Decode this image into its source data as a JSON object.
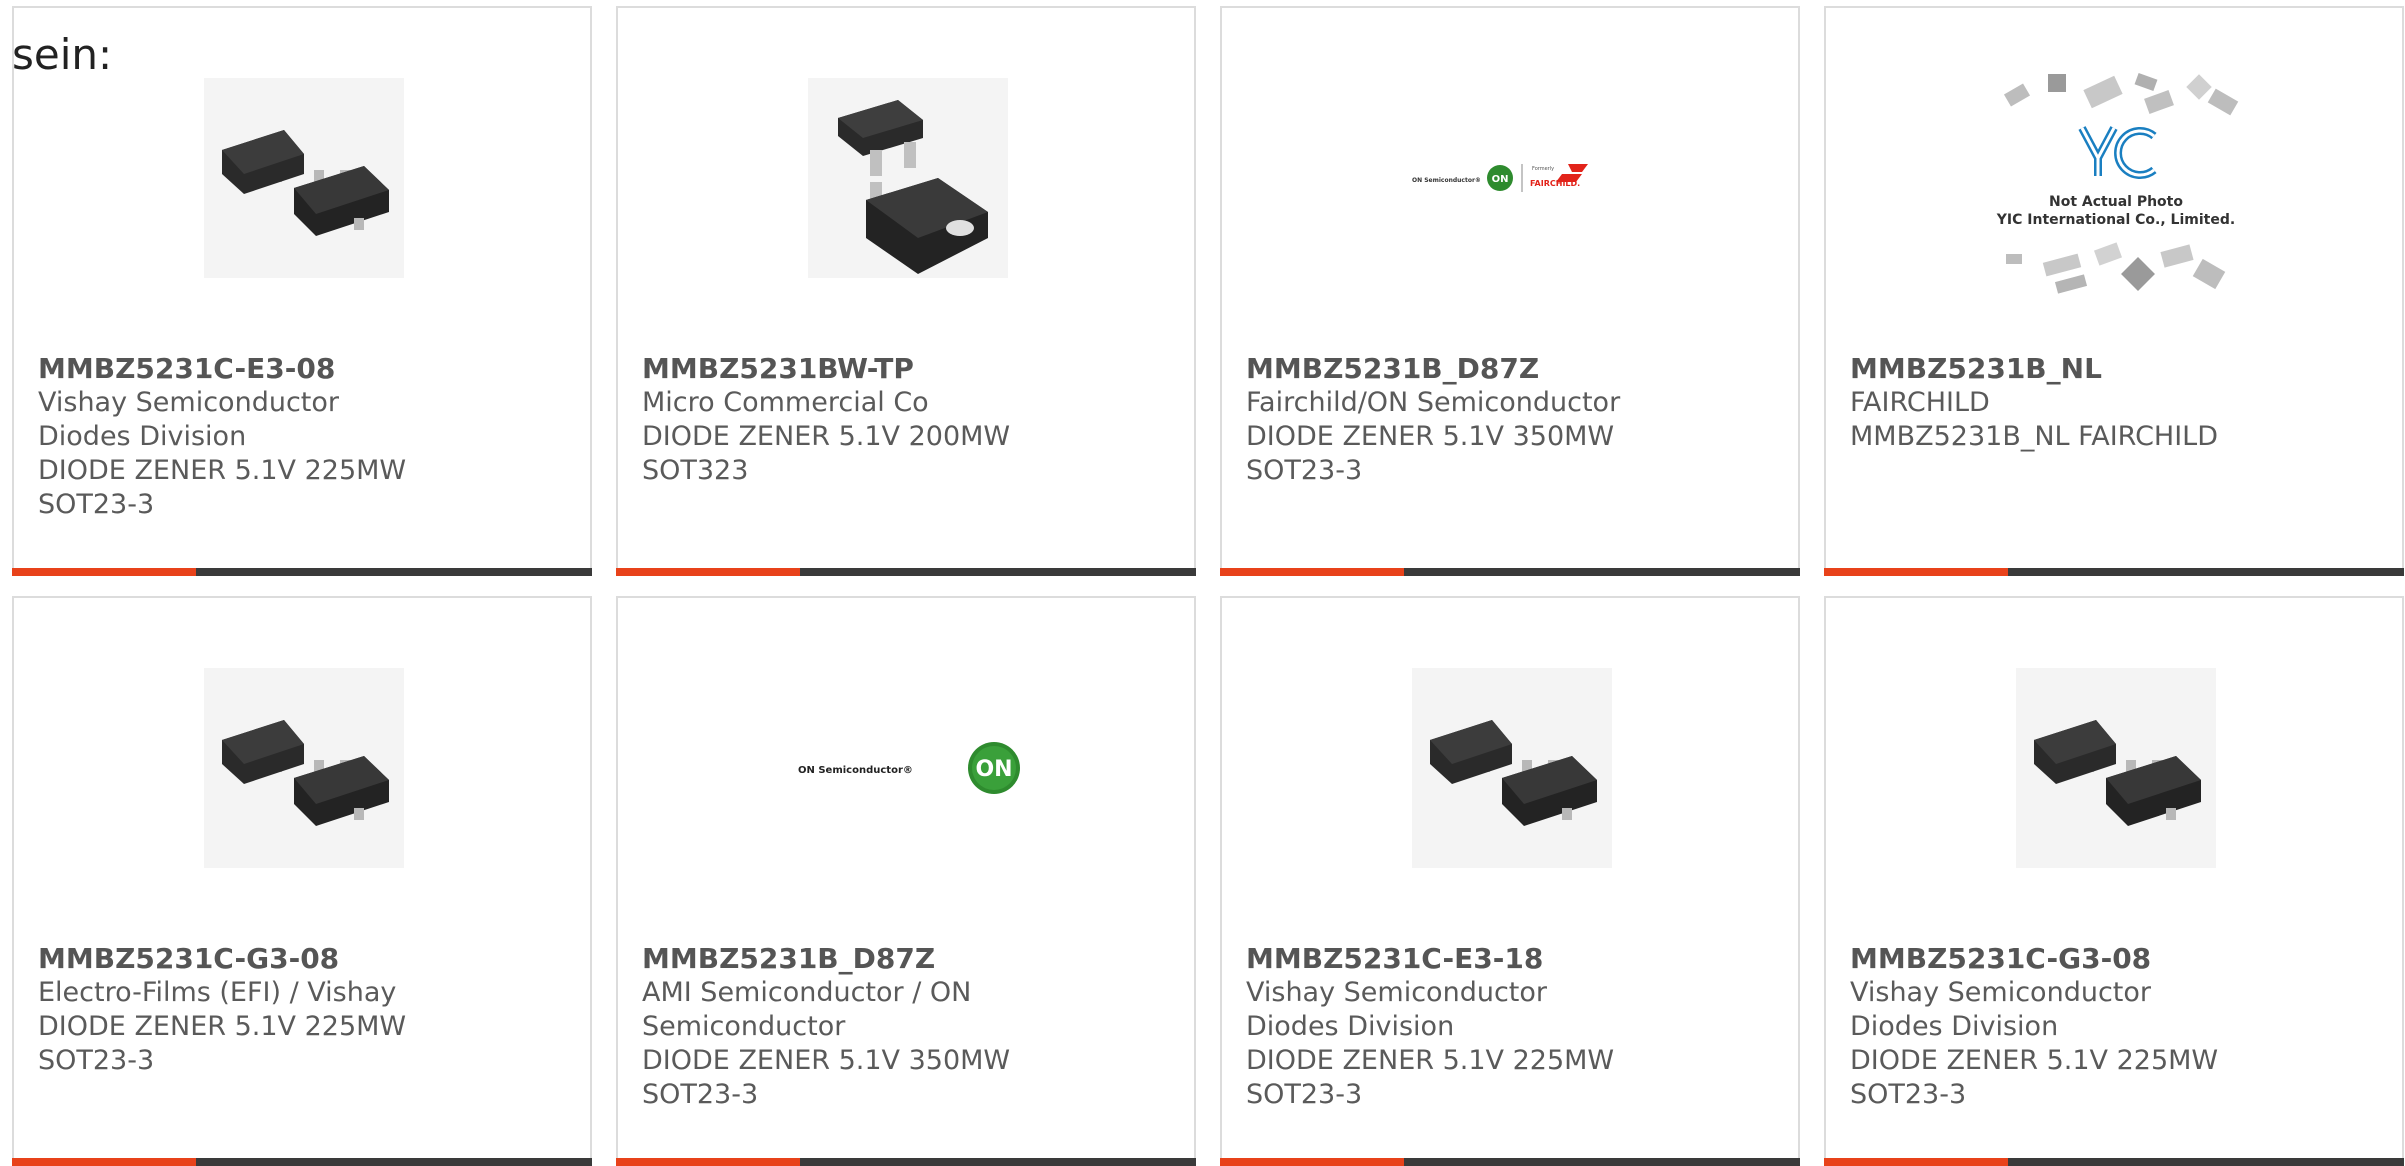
{
  "intro_text": "sein:",
  "products": [
    {
      "part_number": "MMBZ5231C-E3-08",
      "manufacturer": "Vishay Semiconductor Diodes Division",
      "description": "DIODE ZENER 5.1V 225MW",
      "package": "SOT23-3",
      "image": "sot23-package-image"
    },
    {
      "part_number": "MMBZ5231BW-TP",
      "manufacturer": "Micro Commercial Co",
      "description": "DIODE ZENER 5.1V 200MW",
      "package": "SOT323",
      "image": "sot323-package-image"
    },
    {
      "part_number": "MMBZ5231B_D87Z",
      "manufacturer": "Fairchild/ON Semiconductor",
      "description": "DIODE ZENER 5.1V 350MW",
      "package": "SOT23-3",
      "image": "on-fairchild-logo-image",
      "logo_text": {
        "on_semi": "ON Semiconductor®",
        "on": "ON",
        "formerly": "Formerly",
        "fairchild": "FAIRCHILD."
      }
    },
    {
      "part_number": "MMBZ5231B_NL",
      "manufacturer": "FAIRCHILD",
      "description": "MMBZ5231B_NL FAIRCHILD",
      "package": "",
      "image": "yic-not-actual-photo-image",
      "placeholder_text": {
        "brand": "YIC",
        "line1": "Not Actual Photo",
        "line2": "YIC International Co., Limited."
      }
    },
    {
      "part_number": "MMBZ5231C-G3-08",
      "manufacturer": "Electro-Films (EFI) / Vishay",
      "description": "DIODE ZENER 5.1V 225MW",
      "package": "SOT23-3",
      "image": "sot23-package-image"
    },
    {
      "part_number": "MMBZ5231B_D87Z",
      "manufacturer": "AMI Semiconductor / ON Semiconductor",
      "description": "DIODE ZENER 5.1V 350MW",
      "package": "SOT23-3",
      "image": "on-semi-logo-image",
      "logo_text": {
        "on_semi": "ON Semiconductor®",
        "on": "ON"
      }
    },
    {
      "part_number": "MMBZ5231C-E3-18",
      "manufacturer": "Vishay Semiconductor Diodes Division",
      "description": "DIODE ZENER 5.1V 225MW",
      "package": "SOT23-3",
      "image": "sot23-package-image"
    },
    {
      "part_number": "MMBZ5231C-G3-08",
      "manufacturer": "Vishay Semiconductor Diodes Division",
      "description": "DIODE ZENER 5.1V 225MW",
      "package": "SOT23-3",
      "image": "sot23-package-image"
    }
  ],
  "colors": {
    "accent": "#e8421a",
    "bar": "#3a3a3a",
    "card_border": "#dcdcdc",
    "text": "#5a5a5a",
    "on_green": "#2e8b2e",
    "fairchild_red": "#e2231a",
    "yic_blue": "#1a7fc1"
  }
}
